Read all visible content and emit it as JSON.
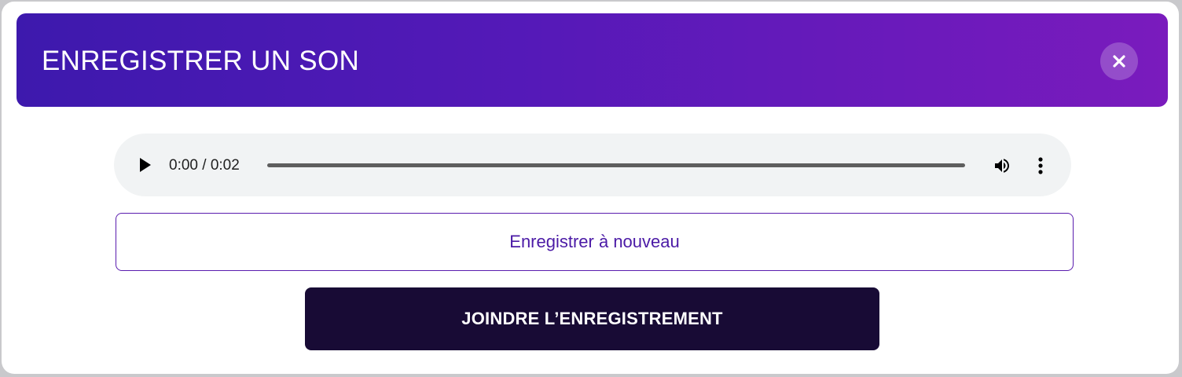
{
  "modal": {
    "title": "ENREGISTRER UN SON",
    "close_icon": "close-icon",
    "header_gradient": [
      "#3d19ad",
      "#7a1bbd"
    ]
  },
  "audio_player": {
    "current_time": "0:00",
    "separator": " / ",
    "duration": "0:02",
    "progress": 0,
    "icons": [
      "play-icon",
      "volume-icon",
      "more-vertical-icon"
    ],
    "background": "#f1f3f4"
  },
  "actions": {
    "rerecord_label": "Enregistrer à nouveau",
    "attach_label": "JOINDRE L’ENREGISTREMENT",
    "accent_color": "#4b1aa6",
    "primary_bg": "#180b35"
  }
}
